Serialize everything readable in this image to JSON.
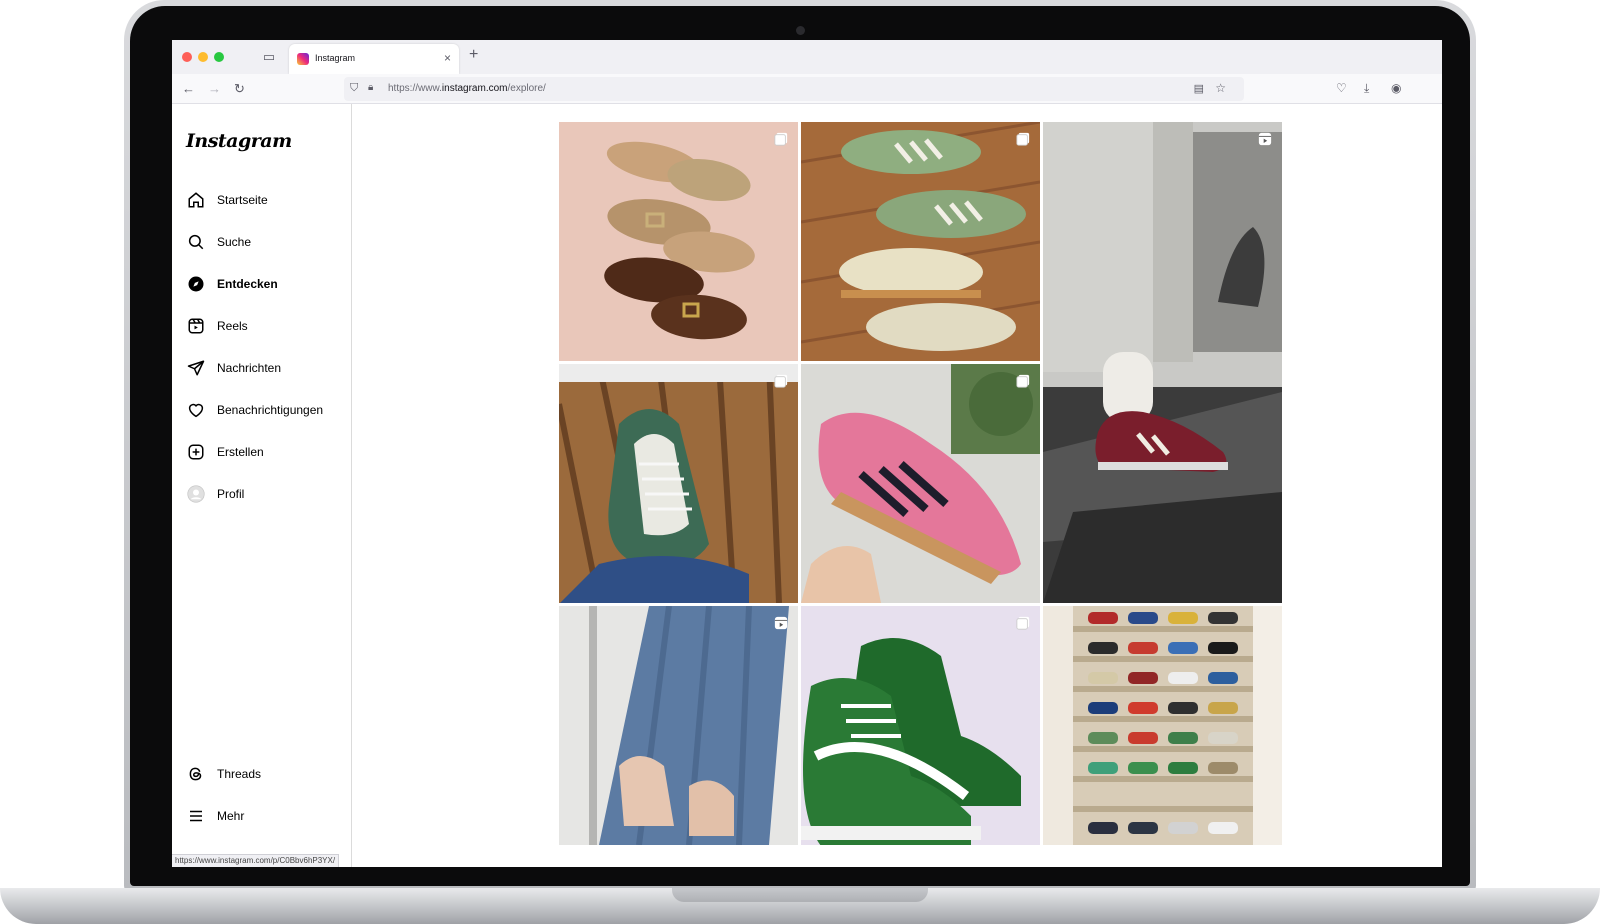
{
  "browser": {
    "tab_title": "Instagram",
    "url_prefix": "https://www.",
    "url_domain": "instagram.com",
    "url_path": "/explore/",
    "status_url": "https://www.instagram.com/p/C0Bbv6hP3YX/"
  },
  "app": {
    "logo": "Instagram"
  },
  "sidebar": {
    "items": [
      {
        "label": "Startseite",
        "icon": "home-icon"
      },
      {
        "label": "Suche",
        "icon": "search-icon"
      },
      {
        "label": "Entdecken",
        "icon": "explore-icon",
        "active": true
      },
      {
        "label": "Reels",
        "icon": "reels-icon"
      },
      {
        "label": "Nachrichten",
        "icon": "messages-icon"
      },
      {
        "label": "Benachrichtigungen",
        "icon": "heart-icon"
      },
      {
        "label": "Erstellen",
        "icon": "create-icon"
      },
      {
        "label": "Profil",
        "icon": "avatar"
      }
    ],
    "bottom_items": [
      {
        "label": "Threads",
        "icon": "threads-icon"
      },
      {
        "label": "Mehr",
        "icon": "menu-icon"
      }
    ]
  },
  "explore_grid": {
    "posts": [
      {
        "subject": "clogs on pink background",
        "type": "carousel"
      },
      {
        "subject": "green and cream sneakers on wood floor",
        "type": "carousel"
      },
      {
        "subject": "burgundy sneaker with ruffled sock",
        "type": "reel"
      },
      {
        "subject": "green patterned sneaker on bench",
        "type": "carousel"
      },
      {
        "subject": "pink suede sneaker in hand",
        "type": "carousel"
      },
      {
        "subject": "legs in jeans and sneakers",
        "type": "reel"
      },
      {
        "subject": "green high-top sneakers",
        "type": "carousel"
      },
      {
        "subject": "sneakers on staircase",
        "type": "none"
      }
    ]
  },
  "colors": {
    "accent": "#0095f6",
    "border": "#dbdbdb",
    "text": "#000000"
  }
}
